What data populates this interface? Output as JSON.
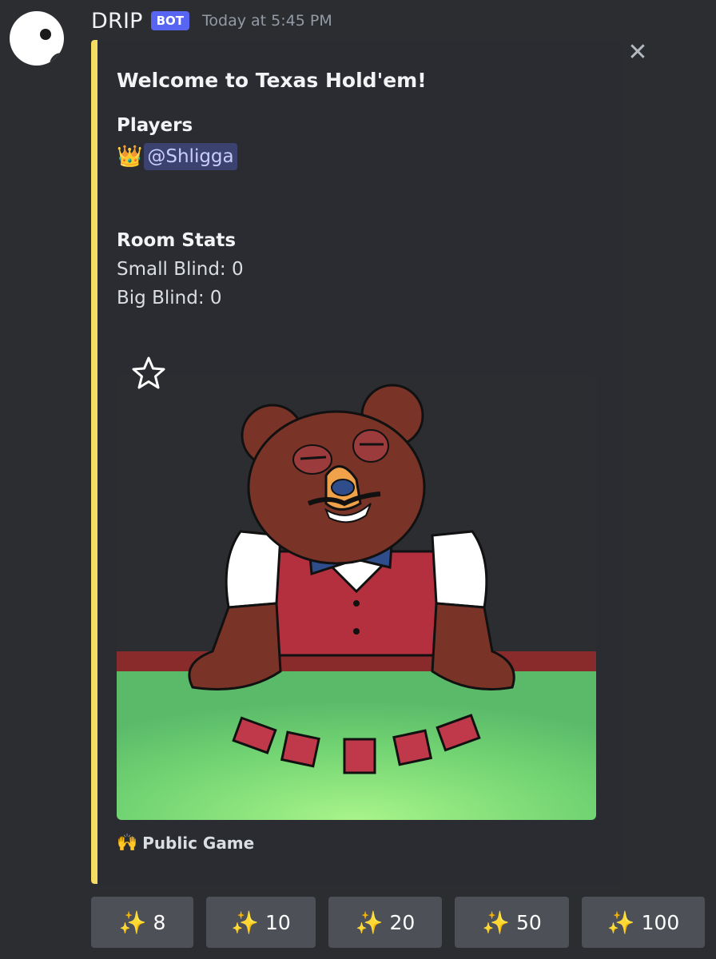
{
  "author": {
    "name": "DRIP",
    "tag": "BOT",
    "timestamp": "Today at 5:45 PM"
  },
  "embed": {
    "title": "Welcome to Texas Hold'em!",
    "players_label": "Players",
    "player_mention": "@Shligga",
    "player_icon": "crown-icon",
    "room_stats_label": "Room Stats",
    "small_blind": "Small Blind: 0",
    "big_blind": "Big Blind: 0",
    "footer_text": "Public Game",
    "footer_icon": "raised-hands-icon",
    "accent_color": "#f5dc62"
  },
  "buttons": [
    {
      "icon": "sparkles-icon",
      "label": "8"
    },
    {
      "icon": "sparkles-icon",
      "label": "10"
    },
    {
      "icon": "sparkles-icon",
      "label": "20"
    },
    {
      "icon": "sparkles-icon",
      "label": "50"
    },
    {
      "icon": "sparkles-icon",
      "label": "100"
    }
  ]
}
